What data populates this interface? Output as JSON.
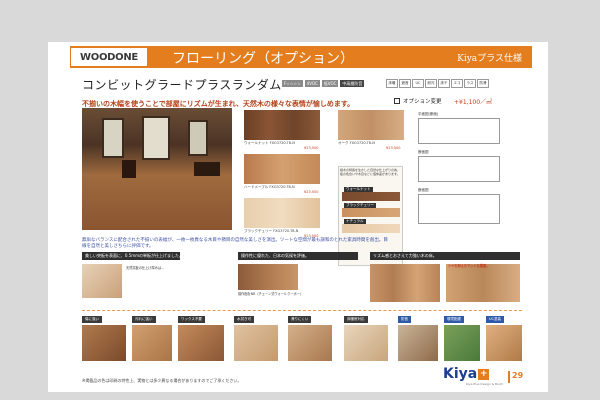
{
  "header": {
    "brand": "WOODONE",
    "title": "フローリング（オプション）",
    "tag": "Kiyaプラス仕様"
  },
  "product": {
    "name": "コンビットグラードプラスランダム",
    "badges": [
      "F☆☆☆☆",
      "4VOC",
      "低VOC",
      "中高層防音"
    ],
    "icons": [
      "床暖",
      "遮音規制",
      "UC",
      "耐汚",
      "床チャン",
      "エコ",
      "ラスチック",
      "防滑"
    ],
    "tagline": "不揃いの木幅を使うことで部屋にリズムが生まれ、天然木の様々な表情が愉しめます。",
    "option_label": "オプション変更",
    "price": "+¥1,100／㎡"
  },
  "swatches": [
    {
      "name": "ウォールナット FXG3720-T8-N",
      "price": "¥23,500",
      "color": "#7a4a2e"
    },
    {
      "name": "オーク FXG3720-T8-N",
      "price": "¥23,500",
      "color": "#c79a6a"
    },
    {
      "name": "ハードメープル FXG3720-T8-N",
      "price": "¥23,500",
      "color": "#d8a87a"
    },
    {
      "name": "チェリー",
      "price": "",
      "color": "#c0814e"
    },
    {
      "name": "ブラックチェリー FXG3720-T8-N",
      "price": "¥23,500",
      "color": "#e3c7a4"
    }
  ],
  "grain": {
    "note": "樹木の特長を生かした自然な仕上がりの為、板の色合いや木目などに個体差があります。",
    "labels": [
      "ウォールナット",
      "ブラックチェリー",
      "ナチュラル"
    ]
  },
  "specs": {
    "plan_title": "平面図(断面)",
    "section_title": "断面図",
    "detail_title": "断面図"
  },
  "intro": "無垢なバランスに配合された不揃いの表幅が、一枚一枚異なる木目や節目の自然な美しさを演出。ツートな空間が最も調和のとれた家具時間を創出。目線を自然と美しさちらに評価です。",
  "features": [
    {
      "bar": "美しい突板を表面に、0.5mmの単板が仕上げました。",
      "text": "天然突板の仕上げ厚みは…"
    },
    {
      "bar": "操作性に優れた、日本の気候を評価。",
      "text": "操作面をNR（チェーン式ウォールクーポー）"
    },
    {
      "bar": "リズム感とおさえて力強い木の床。",
      "text": "幅の異なる木の表情をランダムに配置"
    }
  ],
  "ui_tags": {
    "scratch": "傷に強い",
    "stain": "汚れに強い",
    "wax": "ワックス不要",
    "water": "水拭き可",
    "slip": "滑りにくい",
    "floor": "床暖房対応",
    "sound": "防音",
    "eco": "環境配慮",
    "uc": "UC塗装",
    "coat": "ツヤを抑えたマットな質感。"
  },
  "footnote": "※掲載品の色は印刷の特性上、実物とは多少異なる場合がありますのでご了承ください。",
  "footer": {
    "logo": "Kiya",
    "plus": "+",
    "sub": "Kiya Plus Design & Build",
    "page": "29"
  },
  "colors": {
    "accent": "#e47d1e",
    "brand_blue": "#1d3d8f",
    "price_red": "#c43a1a"
  }
}
